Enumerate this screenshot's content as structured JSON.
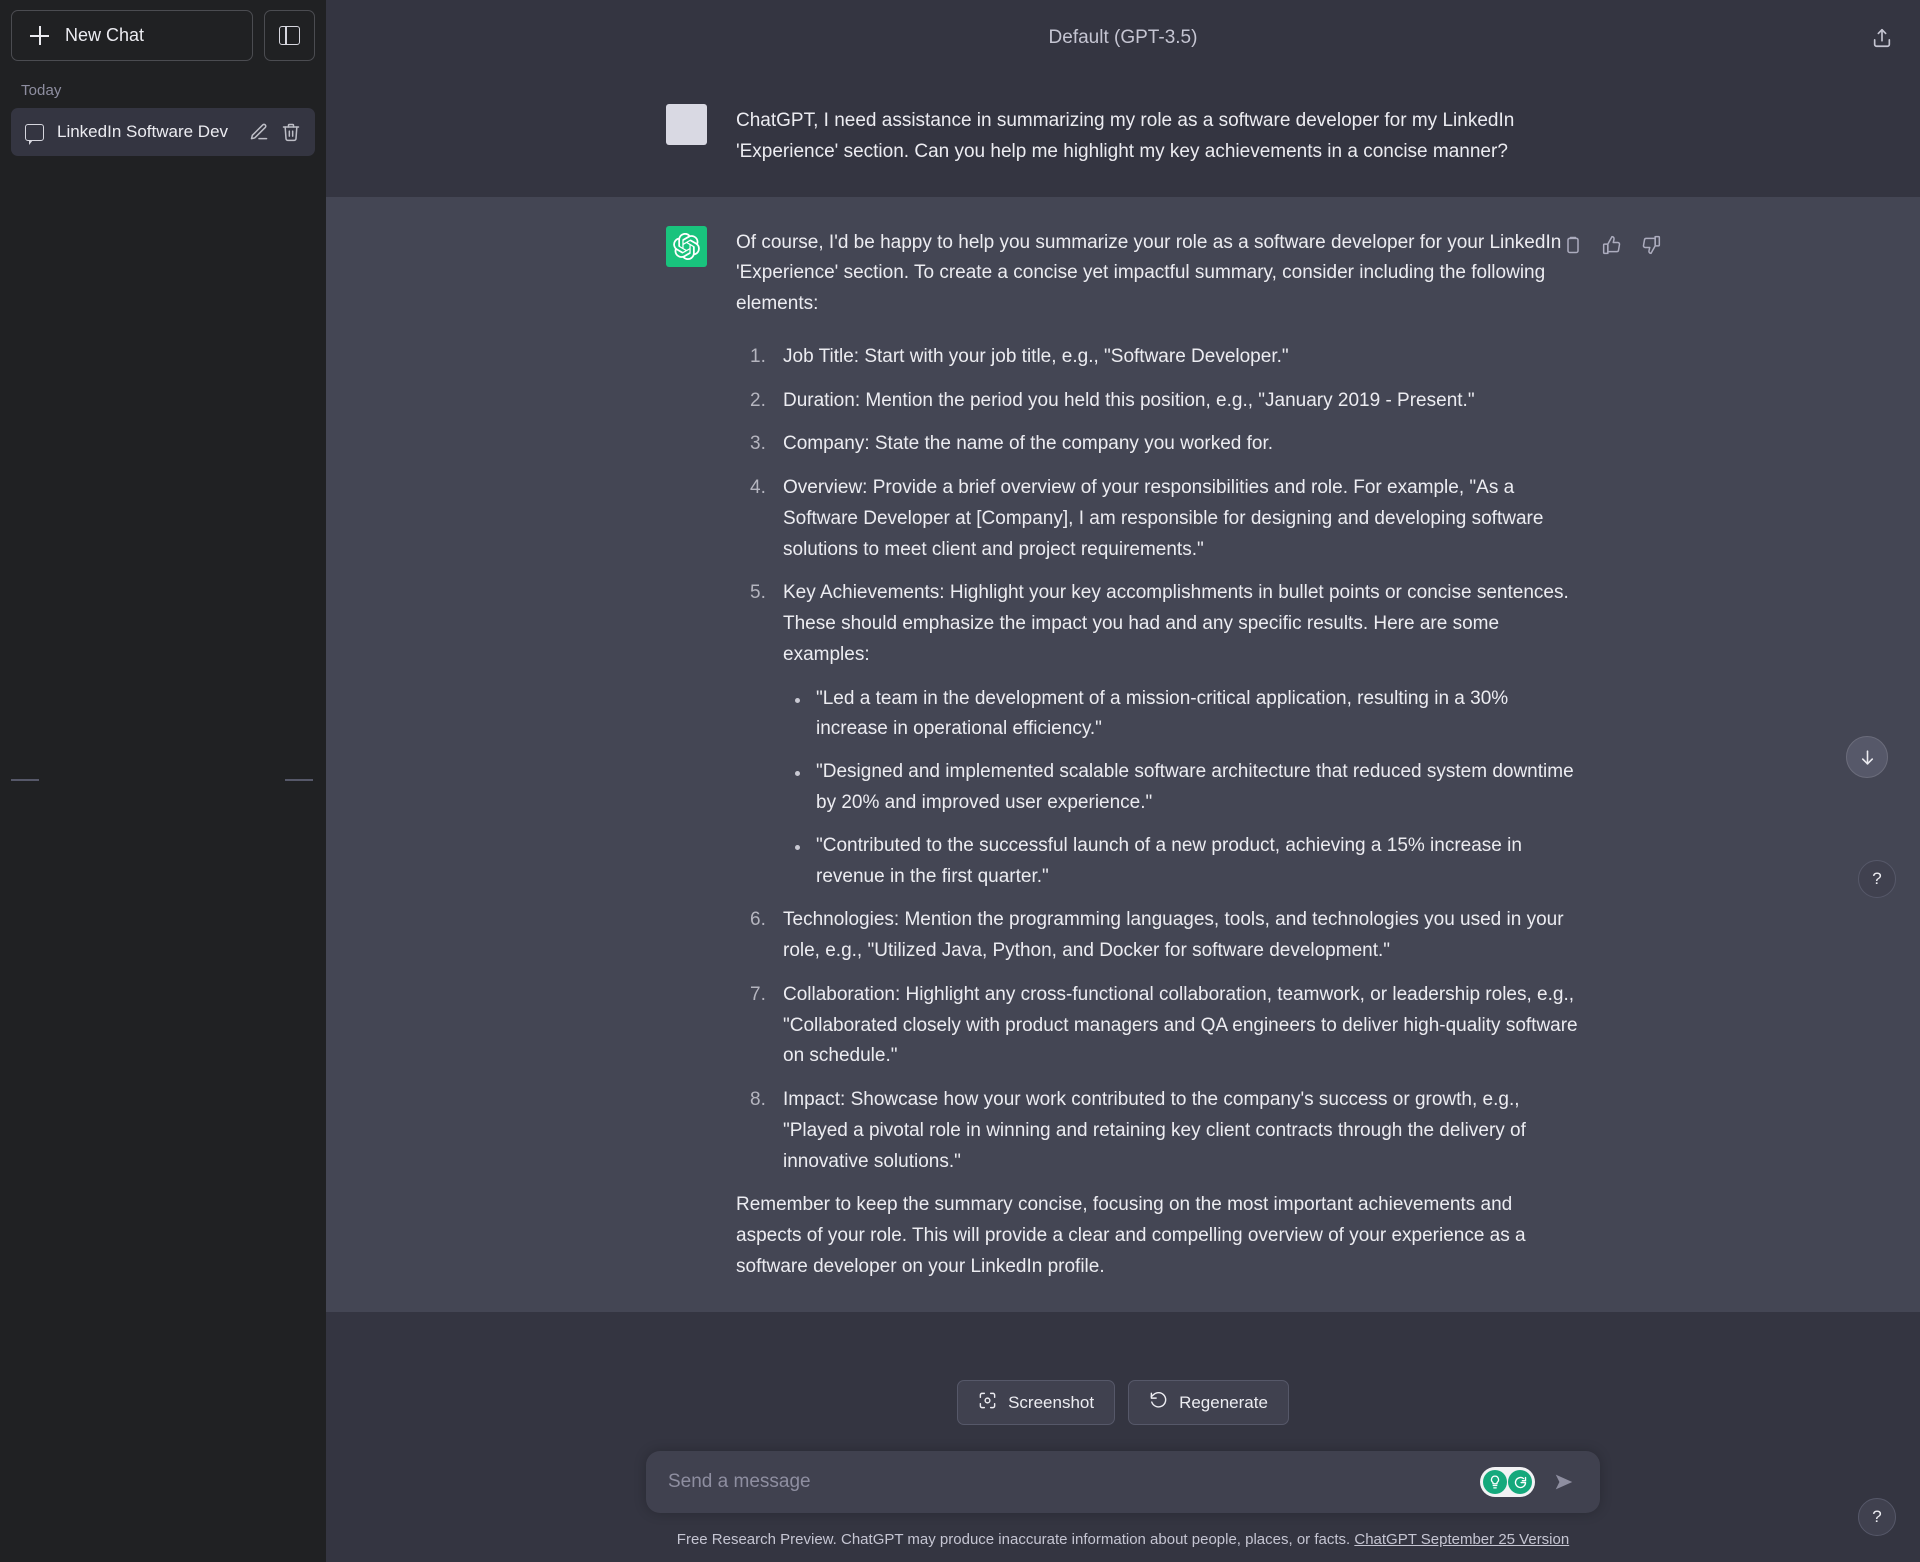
{
  "sidebar": {
    "new_chat_label": "New Chat",
    "new_chat_icon": "plus-icon",
    "collapse_icon": "sidebar-panel-icon",
    "section_label": "Today",
    "chats": [
      {
        "title": "LinkedIn Software Dev",
        "icon": "chat-bubble-icon",
        "edit_icon": "pencil-icon",
        "delete_icon": "trash-icon"
      }
    ]
  },
  "header": {
    "title": "Default (GPT-3.5)",
    "share_icon": "share-upload-icon"
  },
  "messages": [
    {
      "role": "user",
      "avatar": "user-avatar",
      "paragraphs": [
        "ChatGPT, I need assistance in summarizing my role as a software developer for my LinkedIn 'Experience' section. Can you help me highlight my key achievements in a concise manner?"
      ]
    },
    {
      "role": "assistant",
      "avatar": "openai-logo-icon",
      "intro": "Of course, I'd be happy to help you summarize your role as a software developer for your LinkedIn 'Experience' section. To create a concise yet impactful summary, consider including the following elements:",
      "list": [
        "Job Title: Start with your job title, e.g., \"Software Developer.\"",
        "Duration: Mention the period you held this position, e.g., \"January 2019 - Present.\"",
        "Company: State the name of the company you worked for.",
        "Overview: Provide a brief overview of your responsibilities and role. For example, \"As a Software Developer at [Company], I am responsible for designing and developing software solutions to meet client and project requirements.\"",
        "Key Achievements: Highlight your key accomplishments in bullet points or concise sentences. These should emphasize the impact you had and any specific results. Here are some examples:",
        "Technologies: Mention the programming languages, tools, and technologies you used in your role, e.g., \"Utilized Java, Python, and Docker for software development.\"",
        "Collaboration: Highlight any cross-functional collaboration, teamwork, or leadership roles, e.g., \"Collaborated closely with product managers and QA engineers to deliver high-quality software on schedule.\"",
        "Impact: Showcase how your work contributed to the company's success or growth, e.g., \"Played a pivotal role in winning and retaining key client contracts through the delivery of innovative solutions.\""
      ],
      "sublist": [
        "\"Led a team in the development of a mission-critical application, resulting in a 30% increase in operational efficiency.\"",
        "\"Designed and implemented scalable software architecture that reduced system downtime by 20% and improved user experience.\"",
        "\"Contributed to the successful launch of a new product, achieving a 15% increase in revenue in the first quarter.\""
      ],
      "closing": "Remember to keep the summary concise, focusing on the most important achievements and aspects of your role. This will provide a clear and compelling overview of your experience as a software developer on your LinkedIn profile.",
      "actions": [
        {
          "name": "copy-icon"
        },
        {
          "name": "thumbs-up-icon"
        },
        {
          "name": "thumbs-down-icon"
        }
      ]
    }
  ],
  "composer": {
    "screenshot_label": "Screenshot",
    "screenshot_icon": "screenshot-icon",
    "regenerate_label": "Regenerate",
    "regenerate_icon": "refresh-icon",
    "placeholder": "Send a message",
    "value": "",
    "send_icon": "send-arrow-icon",
    "grammarly_icons": [
      "grammarly-lightbulb-icon",
      "grammarly-g-icon"
    ]
  },
  "footer": {
    "text": "Free Research Preview. ChatGPT may produce inaccurate information about people, places, or facts. ",
    "link": "ChatGPT September 25 Version"
  },
  "floating": {
    "scroll_down_icon": "arrow-down-icon",
    "help_label": "?"
  },
  "colors": {
    "sidebar_bg": "#202123",
    "main_bg": "#343541",
    "assistant_bg": "#444654",
    "accent_green": "#19c37d",
    "composer_bg": "#40414f",
    "muted_text": "#8e8ea0"
  }
}
